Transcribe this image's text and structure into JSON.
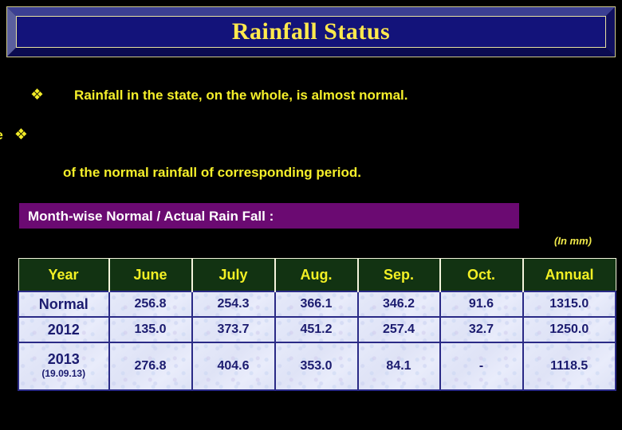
{
  "slide": {
    "title": "Rainfall Status",
    "bullets": [
      {
        "glyph": "❖",
        "text": "Rainfall in the state, on the whole, is almost normal."
      },
      {
        "glyph": "❖",
        "clipped_prefix": "ge",
        "text": "",
        "continuation": "of the normal rainfall of corresponding period."
      }
    ],
    "banner": {
      "label": "Month-wise Normal / Actual  Rain Fall :"
    },
    "unit_note": "(In  mm)"
  },
  "chart_data": {
    "type": "table",
    "title": "Month-wise Normal / Actual  Rain Fall :",
    "unit": "(In  mm)",
    "categories": [
      "June",
      "July",
      "Aug.",
      "Sep.",
      "Oct.",
      "Annual"
    ],
    "columns": [
      "Year",
      "June",
      "July",
      "Aug.",
      "Sep.",
      "Oct.",
      "Annual"
    ],
    "series": [
      {
        "name": "Normal",
        "values": [
          "256.8",
          "254.3",
          "366.1",
          "346.2",
          "91.6",
          "1315.0"
        ]
      },
      {
        "name": "2012",
        "values": [
          "135.0",
          "373.7",
          "451.2",
          "257.4",
          "32.7",
          "1250.0"
        ]
      },
      {
        "name": "2013",
        "values": [
          "276.8",
          "404.6",
          "353.0",
          "84.1",
          "-",
          "1118.5"
        ]
      }
    ],
    "rows": [
      {
        "label": "Normal",
        "sublabel": "",
        "cells": [
          "256.8",
          "254.3",
          "366.1",
          "346.2",
          "91.6",
          "1315.0"
        ]
      },
      {
        "label": "2012",
        "sublabel": "",
        "cells": [
          "135.0",
          "373.7",
          "451.2",
          "257.4",
          "32.7",
          "1250.0"
        ]
      },
      {
        "label": "2013",
        "sublabel": "(19.09.13)",
        "cells": [
          "276.8",
          "404.6",
          "353.0",
          "84.1",
          "-",
          "1118.5"
        ]
      }
    ]
  },
  "colors": {
    "slide_background": "#000000",
    "title_fill": "#13137a",
    "title_text": "#ffe94d",
    "title_border": "#e8e2a0",
    "bullet_text": "#f5ef2a",
    "banner_fill": "#6b0a72",
    "banner_text": "#ffffff",
    "table_header_fill": "#123312",
    "table_header_text": "#f2f024",
    "table_cell_fill": "#e3e7f8",
    "table_cell_text": "#1b1b6f",
    "unit_note_text": "#efe94a"
  }
}
